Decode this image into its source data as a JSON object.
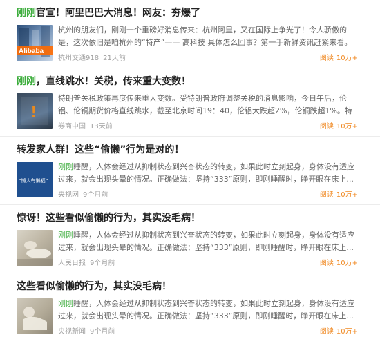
{
  "colors": {
    "highlight": "#3fae3f",
    "read": "#f08a24"
  },
  "items": [
    {
      "title_hl": "刚刚",
      "title_rest": "官宣！阿里巴巴大消息！网友：夯爆了",
      "desc_hl": "",
      "desc": "杭州的朋友们，刚刚一个重磅好消息传来：杭州阿里，又在国际上争光了！令人骄傲的是，这次依旧是咱杭州的“特产”—— 高科技 具体怎么回事？第一手新鲜资讯赶紧来看。",
      "source": "杭州交通918",
      "time": "21天前",
      "read_label": "阅读",
      "read_count": "10万+",
      "thumb_text": "Alibaba",
      "thumb_icon": "building-photo"
    },
    {
      "title_hl": "刚刚",
      "title_rest": "，直线跳水！关税，传来重大变数！",
      "desc_hl": "",
      "desc": "特朗普关税政策再度传来重大变数。受特朗普政府调整关税的消息影响，今日午后，伦铝、伦铜期货价格直线跳水，截至北京时间19：40，伦铝大跌超2%，伦铜跌超1%。特",
      "source": "券商中国",
      "time": "13天前",
      "read_label": "阅读",
      "read_count": "10万+",
      "thumb_text": "!",
      "thumb_icon": "alert-photo"
    },
    {
      "title_hl": "",
      "title_rest": "转发家人群！这些“偷懒”行为是对的！",
      "desc_hl": "刚刚",
      "desc": "睡醒，人体会经过从抑制状态到兴奋状态的转变，如果此时立刻起身，身体没有适应过来，就会出现头晕的情况。正确做法：坚持“333”原则，即刚睡醒时，睁开眼在床上...",
      "source": "央视网",
      "time": "9个月前",
      "read_label": "阅读",
      "read_count": "10万+",
      "thumb_text": "“懒人有懒福”",
      "thumb_icon": "book-photo"
    },
    {
      "title_hl": "",
      "title_rest": "惊讶！这些看似偷懒的行为，其实没毛病！",
      "desc_hl": "刚刚",
      "desc": "睡醒，人体会经过从抑制状态到兴奋状态的转变，如果此时立刻起身，身体没有适应过来，就会出现头晕的情况。正确做法：坚持“333”原则，即刚睡醒时，睁开眼在床上...",
      "source": "人民日报",
      "time": "9个月前",
      "read_label": "阅读",
      "read_count": "10万+",
      "thumb_text": "",
      "thumb_icon": "lying-figure-photo"
    },
    {
      "title_hl": "",
      "title_rest": "这些看似偷懒的行为，其实没毛病！",
      "desc_hl": "刚刚",
      "desc": "睡醒，人体会经过从抑制状态到兴奋状态的转变，如果此时立刻起身，身体没有适应过来，就会出现头晕的情况。正确做法：坚持“333”原则，即刚睡醒时，睁开眼在床上...",
      "source": "央视新闻",
      "time": "9个月前",
      "read_label": "阅读",
      "read_count": "10万+",
      "thumb_text": "",
      "thumb_icon": "resting-figure-photo"
    }
  ]
}
